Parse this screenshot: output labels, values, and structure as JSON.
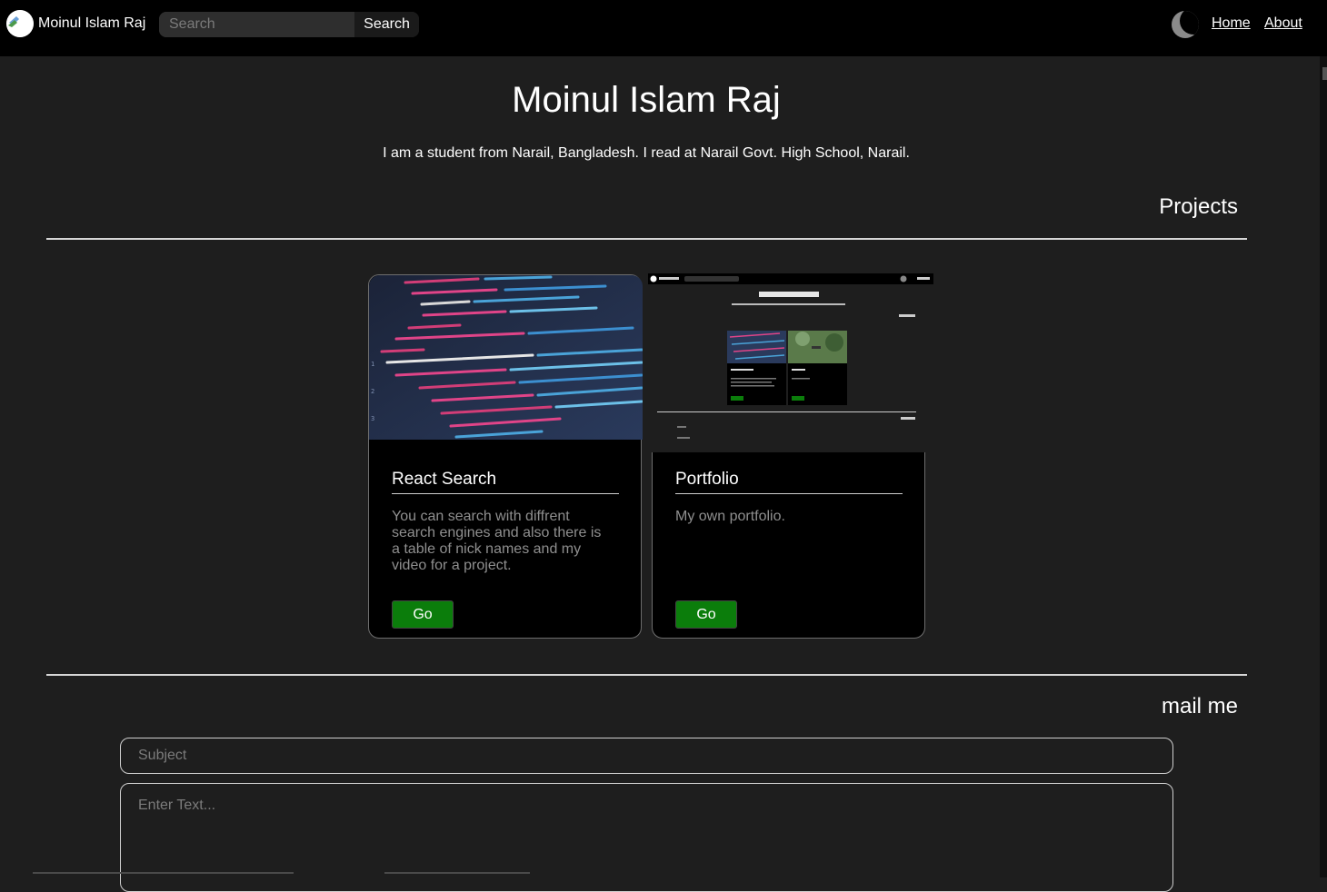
{
  "navbar": {
    "brand": "Moinul Islam Raj",
    "search_placeholder": "Search",
    "search_button": "Search",
    "theme_icon": "moon-icon",
    "links": [
      "Home",
      "About"
    ]
  },
  "hero": {
    "title": "Moinul Islam Raj",
    "subtitle": "I am a student from Narail, Bangladesh. I read at Narail Govt. High School, Narail."
  },
  "projects": {
    "heading": "Projects",
    "cards": [
      {
        "title": "React Search",
        "description": "You can search with diffrent search engines and also there is a table of nick names and my video for a project.",
        "button": "Go",
        "image": "code-screenshot-image"
      },
      {
        "title": "Portfolio",
        "description": "My own portfolio.",
        "button": "Go",
        "image": "portfolio-screenshot-image"
      }
    ]
  },
  "mail": {
    "heading": "mail me",
    "subject_placeholder": "Subject",
    "text_placeholder": "Enter Text..."
  },
  "colors": {
    "background": "#1e1e1e",
    "navbar": "#000000",
    "button_green": "#0b7d0b",
    "muted_text": "#8f8f8f"
  }
}
